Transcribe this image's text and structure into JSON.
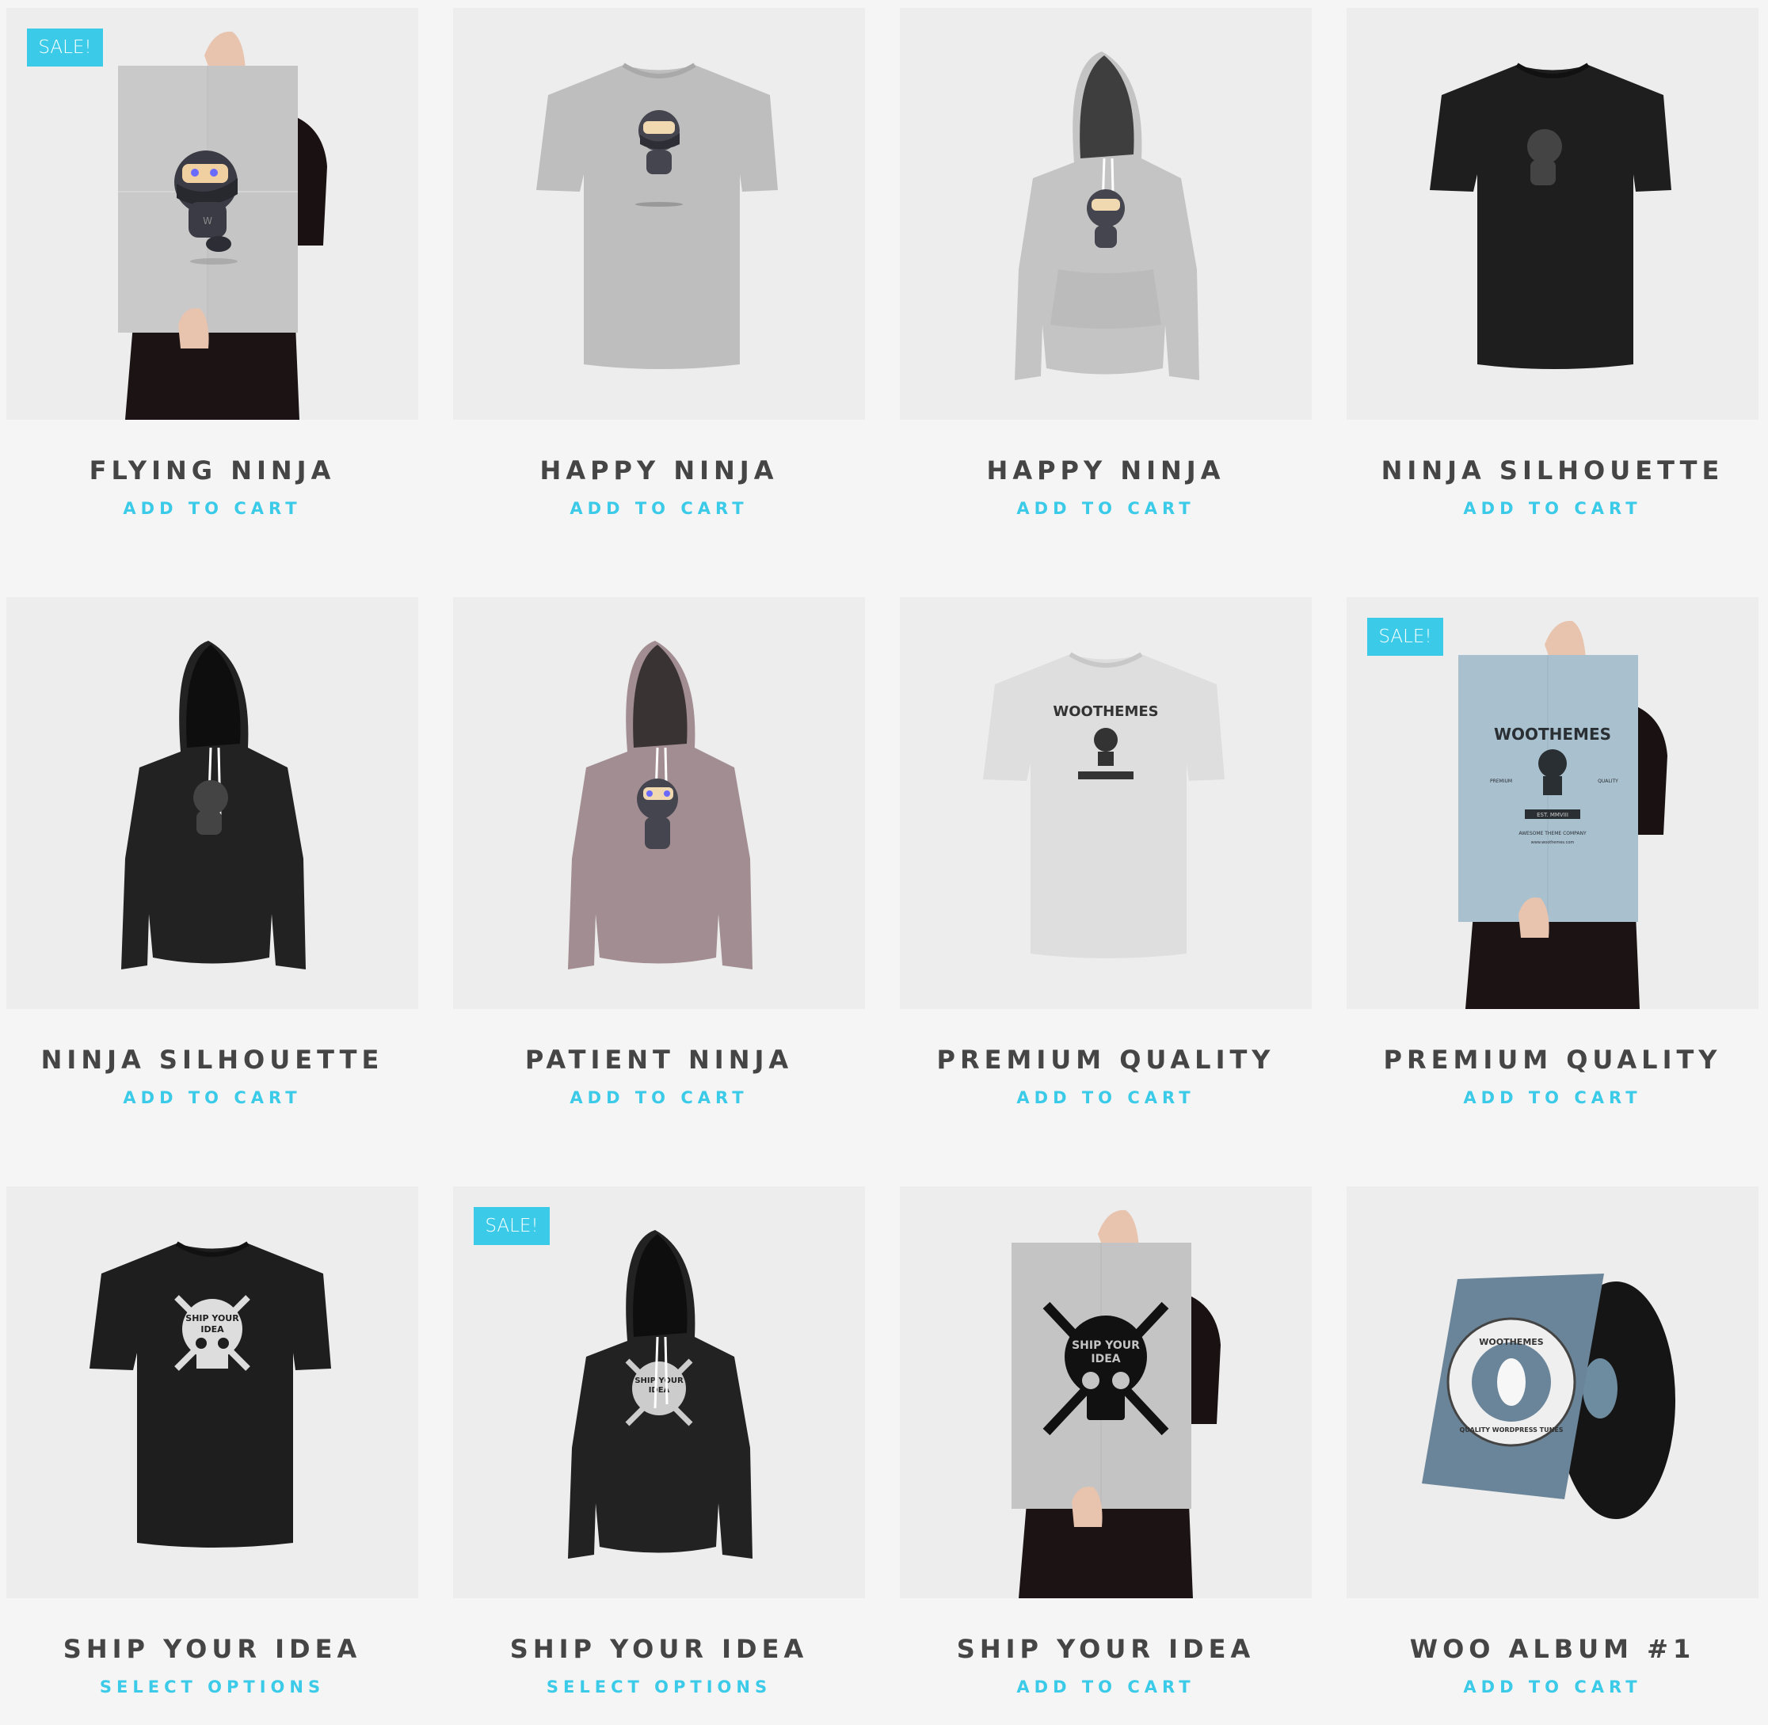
{
  "colors": {
    "accent": "#3bcbe9",
    "title": "#454545",
    "card_bg": "#ededed",
    "page_bg": "#f5f5f5"
  },
  "products": [
    {
      "name": "Flying Ninja",
      "action": "Add to cart",
      "sale": true,
      "sale_label": "SALE!",
      "image": "poster-flying-ninja"
    },
    {
      "name": "Happy Ninja",
      "action": "Add to cart",
      "sale": false,
      "image": "tshirt-grey-happy-ninja"
    },
    {
      "name": "Happy Ninja",
      "action": "Add to cart",
      "sale": false,
      "image": "hoodie-grey-happy-ninja"
    },
    {
      "name": "Ninja Silhouette",
      "action": "Add to cart",
      "sale": false,
      "image": "tshirt-black-ninja-silhouette"
    },
    {
      "name": "Ninja Silhouette",
      "action": "Add to cart",
      "sale": false,
      "image": "hoodie-black-ninja-silhouette"
    },
    {
      "name": "Patient Ninja",
      "action": "Add to cart",
      "sale": false,
      "image": "hoodie-mauve-patient-ninja"
    },
    {
      "name": "Premium Quality",
      "action": "Add to cart",
      "sale": false,
      "image": "tshirt-white-woothemes"
    },
    {
      "name": "Premium Quality",
      "action": "Add to cart",
      "sale": true,
      "sale_label": "SALE!",
      "image": "poster-blue-woothemes"
    },
    {
      "name": "Ship Your Idea",
      "action": "Select options",
      "sale": false,
      "image": "tshirt-black-ship-your-idea"
    },
    {
      "name": "Ship Your Idea",
      "action": "Select options",
      "sale": true,
      "sale_label": "SALE!",
      "image": "hoodie-black-ship-your-idea"
    },
    {
      "name": "Ship Your Idea",
      "action": "Add to cart",
      "sale": false,
      "image": "poster-ship-your-idea"
    },
    {
      "name": "Woo Album #1",
      "action": "Add to cart",
      "sale": false,
      "image": "vinyl-album-woothemes"
    }
  ],
  "artwork": {
    "woothemes": "WOOTHEMES",
    "premium": "PREMIUM",
    "quality": "QUALITY",
    "est": "EST. MMVIII",
    "company": "AWESOME THEME COMPANY",
    "url": "www.woothemes.com",
    "ship_line1": "SHIP YOUR",
    "ship_line2": "IDEA",
    "album_tagline": "QUALITY WORDPRESS TUNES",
    "ninja_letter": "W"
  }
}
